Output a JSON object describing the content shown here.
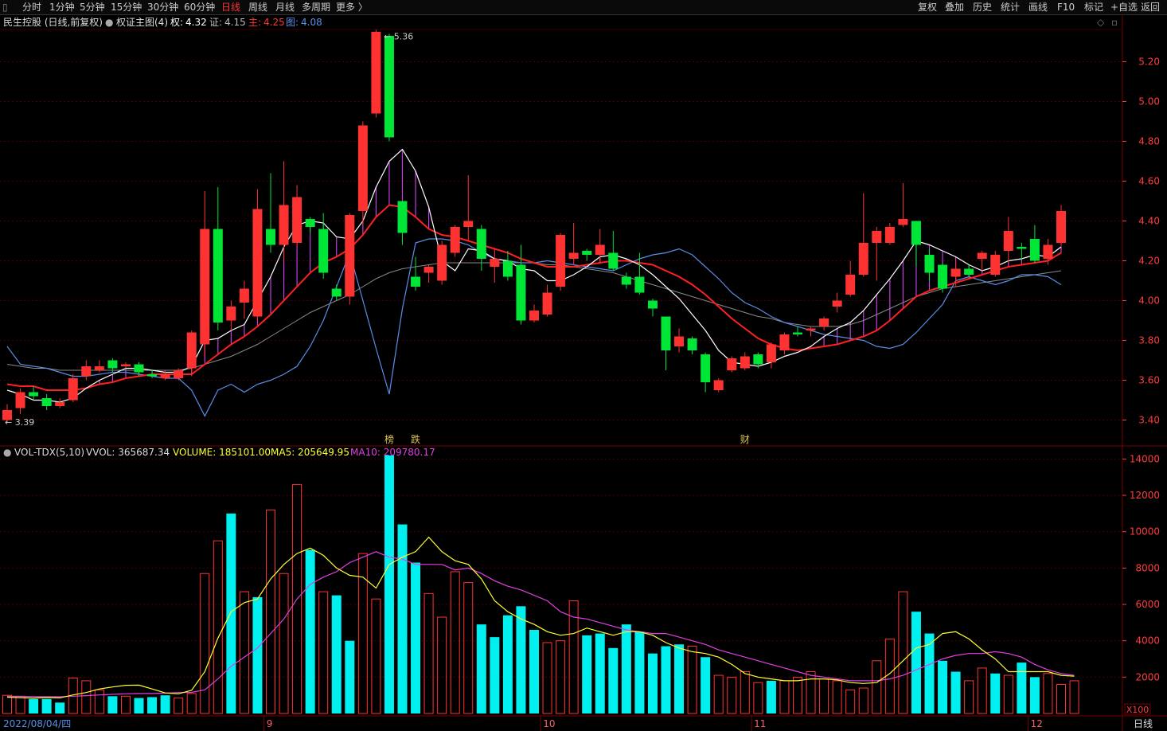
{
  "toolbar": {
    "left_tabs": [
      "分时",
      "1分钟",
      "5分钟",
      "15分钟",
      "30分钟",
      "60分钟",
      "日线",
      "周线",
      "月线",
      "多周期",
      "更多 〉"
    ],
    "active_tab": "日线",
    "right_buttons": [
      "复权",
      "叠加",
      "历史",
      "统计",
      "画线",
      "F10",
      "标记",
      "+自选",
      "返回"
    ]
  },
  "info": {
    "stock": "民生控股 (日线,前复权)",
    "indicator": "权证主图(4)",
    "quan_label": "权:",
    "quan": "4.32",
    "zheng_label": "证:",
    "zheng": "4.15",
    "zhu_label": "主:",
    "zhu": "4.25",
    "tu_label": "图:",
    "tu": "4.08"
  },
  "vol_info": {
    "name": "VOL-TDX(5,10)",
    "vvol": "VVOL: 365687.34",
    "volume": "VOLUME: 185101.00",
    "ma5": "MA5: 205649.95",
    "ma10": "MA10: 209780.17"
  },
  "colors": {
    "up": "#ff3232",
    "down": "#00e636",
    "vol_down": "#00f0f0",
    "ma5": "#ffffff",
    "ma10": "#ff2020",
    "slow_line": "#5a8ee6",
    "vol_ma5": "#ffff30",
    "vol_ma10": "#e040e0",
    "axis_price": "#ff3c3c",
    "grid": "#4a0000"
  },
  "chart_data": [
    {
      "type": "candlestick",
      "title": "民生控股 (日线,前复权)",
      "ylim": [
        3.35,
        5.35
      ],
      "yticks": [
        "5.20",
        "5.00",
        "4.80",
        "4.60",
        "4.40",
        "4.20",
        "4.00",
        "3.80",
        "3.60",
        "3.40"
      ],
      "high_label": "5.36",
      "low_label": "3.39",
      "event_marks": [
        "榜",
        "跌",
        "财"
      ],
      "candles": [
        {
          "o": 3.4,
          "c": 3.45,
          "h": 3.48,
          "l": 3.39
        },
        {
          "o": 3.46,
          "c": 3.54,
          "h": 3.56,
          "l": 3.43
        },
        {
          "o": 3.54,
          "c": 3.52,
          "h": 3.57,
          "l": 3.5
        },
        {
          "o": 3.51,
          "c": 3.47,
          "h": 3.53,
          "l": 3.45
        },
        {
          "o": 3.47,
          "c": 3.49,
          "h": 3.51,
          "l": 3.46
        },
        {
          "o": 3.5,
          "c": 3.61,
          "h": 3.63,
          "l": 3.49
        },
        {
          "o": 3.62,
          "c": 3.67,
          "h": 3.7,
          "l": 3.6
        },
        {
          "o": 3.65,
          "c": 3.67,
          "h": 3.7,
          "l": 3.64
        },
        {
          "o": 3.7,
          "c": 3.66,
          "h": 3.71,
          "l": 3.64
        },
        {
          "o": 3.67,
          "c": 3.68,
          "h": 3.69,
          "l": 3.66
        },
        {
          "o": 3.68,
          "c": 3.64,
          "h": 3.69,
          "l": 3.62
        },
        {
          "o": 3.63,
          "c": 3.62,
          "h": 3.65,
          "l": 3.61
        },
        {
          "o": 3.61,
          "c": 3.63,
          "h": 3.65,
          "l": 3.6
        },
        {
          "o": 3.61,
          "c": 3.65,
          "h": 3.66,
          "l": 3.6
        },
        {
          "o": 3.66,
          "c": 3.84,
          "h": 3.85,
          "l": 3.62
        },
        {
          "o": 3.78,
          "c": 4.36,
          "h": 4.55,
          "l": 3.72
        },
        {
          "o": 4.36,
          "c": 3.89,
          "h": 4.57,
          "l": 3.85
        },
        {
          "o": 3.9,
          "c": 3.97,
          "h": 4.0,
          "l": 3.85
        },
        {
          "o": 3.99,
          "c": 4.06,
          "h": 4.1,
          "l": 3.91
        },
        {
          "o": 3.92,
          "c": 4.46,
          "h": 4.56,
          "l": 3.9
        },
        {
          "o": 4.36,
          "c": 4.28,
          "h": 4.64,
          "l": 4.24
        },
        {
          "o": 4.28,
          "c": 4.48,
          "h": 4.7,
          "l": 4.2
        },
        {
          "o": 4.29,
          "c": 4.52,
          "h": 4.58,
          "l": 4.27
        },
        {
          "o": 4.41,
          "c": 4.37,
          "h": 4.42,
          "l": 4.34
        },
        {
          "o": 4.36,
          "c": 4.14,
          "h": 4.44,
          "l": 4.11
        },
        {
          "o": 4.06,
          "c": 4.02,
          "h": 4.08,
          "l": 4.0
        },
        {
          "o": 4.02,
          "c": 4.43,
          "h": 4.44,
          "l": 3.98
        },
        {
          "o": 4.45,
          "c": 4.88,
          "h": 4.9,
          "l": 4.38
        },
        {
          "o": 4.94,
          "c": 5.35,
          "h": 5.36,
          "l": 4.92
        },
        {
          "o": 5.33,
          "c": 4.82,
          "h": 5.34,
          "l": 4.8
        },
        {
          "o": 4.5,
          "c": 4.34,
          "h": 4.5,
          "l": 4.28
        },
        {
          "o": 4.12,
          "c": 4.07,
          "h": 4.22,
          "l": 4.05
        },
        {
          "o": 4.14,
          "c": 4.17,
          "h": 4.18,
          "l": 4.09
        },
        {
          "o": 4.1,
          "c": 4.28,
          "h": 4.3,
          "l": 4.08
        },
        {
          "o": 4.24,
          "c": 4.37,
          "h": 4.38,
          "l": 4.22
        },
        {
          "o": 4.37,
          "c": 4.4,
          "h": 4.63,
          "l": 4.3
        },
        {
          "o": 4.36,
          "c": 4.21,
          "h": 4.38,
          "l": 4.15
        },
        {
          "o": 4.17,
          "c": 4.21,
          "h": 4.26,
          "l": 4.09
        },
        {
          "o": 4.2,
          "c": 4.12,
          "h": 4.25,
          "l": 4.1
        },
        {
          "o": 4.18,
          "c": 3.9,
          "h": 4.28,
          "l": 3.88
        },
        {
          "o": 3.9,
          "c": 3.95,
          "h": 3.98,
          "l": 3.89
        },
        {
          "o": 3.93,
          "c": 4.04,
          "h": 4.08,
          "l": 3.92
        },
        {
          "o": 4.07,
          "c": 4.33,
          "h": 4.34,
          "l": 4.05
        },
        {
          "o": 4.21,
          "c": 4.24,
          "h": 4.39,
          "l": 4.18
        },
        {
          "o": 4.25,
          "c": 4.23,
          "h": 4.26,
          "l": 4.2
        },
        {
          "o": 4.23,
          "c": 4.28,
          "h": 4.36,
          "l": 4.19
        },
        {
          "o": 4.24,
          "c": 4.16,
          "h": 4.35,
          "l": 4.15
        },
        {
          "o": 4.12,
          "c": 4.08,
          "h": 4.14,
          "l": 4.06
        },
        {
          "o": 4.12,
          "c": 4.04,
          "h": 4.24,
          "l": 4.03
        },
        {
          "o": 4.0,
          "c": 3.96,
          "h": 4.01,
          "l": 3.92
        },
        {
          "o": 3.92,
          "c": 3.75,
          "h": 3.92,
          "l": 3.65
        },
        {
          "o": 3.77,
          "c": 3.82,
          "h": 3.86,
          "l": 3.74
        },
        {
          "o": 3.81,
          "c": 3.75,
          "h": 3.82,
          "l": 3.73
        },
        {
          "o": 3.73,
          "c": 3.59,
          "h": 3.74,
          "l": 3.54
        },
        {
          "o": 3.55,
          "c": 3.6,
          "h": 3.61,
          "l": 3.54
        },
        {
          "o": 3.65,
          "c": 3.71,
          "h": 3.72,
          "l": 3.64
        },
        {
          "o": 3.66,
          "c": 3.72,
          "h": 3.74,
          "l": 3.65
        },
        {
          "o": 3.73,
          "c": 3.68,
          "h": 3.74,
          "l": 3.66
        },
        {
          "o": 3.69,
          "c": 3.78,
          "h": 3.79,
          "l": 3.66
        },
        {
          "o": 3.75,
          "c": 3.83,
          "h": 3.84,
          "l": 3.73
        },
        {
          "o": 3.84,
          "c": 3.83,
          "h": 3.87,
          "l": 3.82
        },
        {
          "o": 3.85,
          "c": 3.86,
          "h": 3.87,
          "l": 3.82
        },
        {
          "o": 3.87,
          "c": 3.91,
          "h": 3.92,
          "l": 3.85
        },
        {
          "o": 3.97,
          "c": 4.0,
          "h": 4.04,
          "l": 3.94
        },
        {
          "o": 4.03,
          "c": 4.13,
          "h": 4.2,
          "l": 4.02
        },
        {
          "o": 4.13,
          "c": 4.29,
          "h": 4.54,
          "l": 4.12
        },
        {
          "o": 4.29,
          "c": 4.35,
          "h": 4.37,
          "l": 4.1
        },
        {
          "o": 4.29,
          "c": 4.37,
          "h": 4.39,
          "l": 4.28
        },
        {
          "o": 4.38,
          "c": 4.41,
          "h": 4.59,
          "l": 4.37
        },
        {
          "o": 4.4,
          "c": 4.28,
          "h": 4.4,
          "l": 4.17
        },
        {
          "o": 4.23,
          "c": 4.14,
          "h": 4.26,
          "l": 4.1
        },
        {
          "o": 4.18,
          "c": 4.06,
          "h": 4.19,
          "l": 4.04
        },
        {
          "o": 4.12,
          "c": 4.16,
          "h": 4.2,
          "l": 4.07
        },
        {
          "o": 4.16,
          "c": 4.13,
          "h": 4.18,
          "l": 4.12
        },
        {
          "o": 4.21,
          "c": 4.24,
          "h": 4.25,
          "l": 4.15
        },
        {
          "o": 4.13,
          "c": 4.23,
          "h": 4.25,
          "l": 4.12
        },
        {
          "o": 4.25,
          "c": 4.35,
          "h": 4.42,
          "l": 4.19
        },
        {
          "o": 4.27,
          "c": 4.26,
          "h": 4.29,
          "l": 4.2
        },
        {
          "o": 4.31,
          "c": 4.2,
          "h": 4.38,
          "l": 4.19
        },
        {
          "o": 4.21,
          "c": 4.28,
          "h": 4.31,
          "l": 4.18
        },
        {
          "o": 4.29,
          "c": 4.45,
          "h": 4.48,
          "l": 4.27
        }
      ],
      "ma_fast": [
        3.55,
        3.53,
        3.5,
        3.5,
        3.49,
        3.51,
        3.56,
        3.6,
        3.63,
        3.66,
        3.66,
        3.65,
        3.64,
        3.64,
        3.67,
        3.8,
        3.81,
        3.85,
        3.88,
        4.0,
        4.12,
        4.27,
        4.38,
        4.4,
        4.39,
        4.32,
        4.31,
        4.4,
        4.57,
        4.7,
        4.76,
        4.65,
        4.47,
        4.2,
        4.15,
        4.26,
        4.25,
        4.21,
        4.2,
        4.16,
        4.15,
        4.1,
        4.1,
        4.13,
        4.17,
        4.22,
        4.23,
        4.21,
        4.18,
        4.13,
        4.07,
        4.01,
        3.93,
        3.85,
        3.75,
        3.69,
        3.68,
        3.67,
        3.69,
        3.72,
        3.74,
        3.77,
        3.82,
        3.86,
        3.89,
        3.95,
        4.03,
        4.11,
        4.2,
        4.3,
        4.28,
        4.25,
        4.22,
        4.18,
        4.15,
        4.17,
        4.2,
        4.21,
        4.23,
        4.22,
        4.27
      ],
      "ma_mid": [
        3.58,
        3.57,
        3.57,
        3.55,
        3.55,
        3.55,
        3.56,
        3.58,
        3.59,
        3.61,
        3.62,
        3.63,
        3.63,
        3.63,
        3.63,
        3.68,
        3.73,
        3.78,
        3.82,
        3.87,
        3.93,
        4.0,
        4.07,
        4.14,
        4.19,
        4.22,
        4.26,
        4.33,
        4.42,
        4.48,
        4.47,
        4.42,
        4.36,
        4.33,
        4.32,
        4.3,
        4.28,
        4.26,
        4.24,
        4.21,
        4.19,
        4.17,
        4.17,
        4.17,
        4.18,
        4.19,
        4.2,
        4.2,
        4.19,
        4.18,
        4.15,
        4.12,
        4.08,
        4.03,
        3.97,
        3.91,
        3.86,
        3.81,
        3.78,
        3.76,
        3.75,
        3.76,
        3.77,
        3.78,
        3.8,
        3.82,
        3.85,
        3.9,
        3.96,
        4.02,
        4.05,
        4.07,
        4.09,
        4.11,
        4.13,
        4.15,
        4.17,
        4.18,
        4.19,
        4.2,
        4.24
      ],
      "ma_slow": [
        3.77,
        3.68,
        3.67,
        3.66,
        3.64,
        3.62,
        3.62,
        3.63,
        3.64,
        3.64,
        3.63,
        3.62,
        3.61,
        3.61,
        3.55,
        3.42,
        3.55,
        3.58,
        3.54,
        3.58,
        3.6,
        3.63,
        3.67,
        3.77,
        3.9,
        4.07,
        4.24,
        4.0,
        3.76,
        3.53,
        3.96,
        4.29,
        4.31,
        4.31,
        4.3,
        4.28,
        4.24,
        4.21,
        4.2,
        4.19,
        4.19,
        4.2,
        4.19,
        4.18,
        4.17,
        4.16,
        4.15,
        4.18,
        4.21,
        4.23,
        4.24,
        4.26,
        4.23,
        4.17,
        4.11,
        4.04,
        3.99,
        3.96,
        3.92,
        3.89,
        3.87,
        3.85,
        3.83,
        3.82,
        3.81,
        3.8,
        3.77,
        3.76,
        3.78,
        3.84,
        3.91,
        3.98,
        4.1,
        4.12,
        4.1,
        4.08,
        4.1,
        4.13,
        4.13,
        4.12,
        4.08
      ],
      "ma_long": [
        3.68,
        3.67,
        3.66,
        3.66,
        3.65,
        3.65,
        3.65,
        3.65,
        3.65,
        3.65,
        3.65,
        3.65,
        3.65,
        3.65,
        3.66,
        3.68,
        3.7,
        3.72,
        3.75,
        3.78,
        3.82,
        3.86,
        3.9,
        3.94,
        3.97,
        4.0,
        4.03,
        4.07,
        4.11,
        4.14,
        4.16,
        4.17,
        4.18,
        4.19,
        4.19,
        4.19,
        4.19,
        4.19,
        4.19,
        4.19,
        4.19,
        4.18,
        4.18,
        4.17,
        4.16,
        4.15,
        4.14,
        4.12,
        4.1,
        4.08,
        4.06,
        4.04,
        4.02,
        4.0,
        3.98,
        3.96,
        3.94,
        3.92,
        3.91,
        3.89,
        3.88,
        3.87,
        3.87,
        3.87,
        3.88,
        3.9,
        3.93,
        3.96,
        3.99,
        4.02,
        4.04,
        4.06,
        4.07,
        4.08,
        4.09,
        4.1,
        4.11,
        4.12,
        4.13,
        4.14,
        4.15
      ]
    },
    {
      "type": "bar",
      "title": "VOL-TDX(5,10)",
      "ylim": [
        0,
        14500
      ],
      "yticks": [
        "14000",
        "12000",
        "10000",
        "8000",
        "6000",
        "4000",
        "2000"
      ],
      "unit_label": "X100",
      "x_labels": [
        "2022/08/04/四",
        "9",
        "10",
        "11",
        "12"
      ],
      "x_label_index": [
        0,
        20,
        41,
        57,
        78
      ],
      "period_label": "日线",
      "volume": [
        1000,
        950,
        800,
        800,
        600,
        1950,
        1800,
        1300,
        950,
        950,
        850,
        900,
        1000,
        850,
        1100,
        7700,
        9500,
        11000,
        6700,
        6400,
        11200,
        7700,
        12600,
        9000,
        6700,
        6500,
        4000,
        8800,
        6300,
        14200,
        10400,
        8300,
        6600,
        5300,
        7800,
        7200,
        4900,
        4200,
        5400,
        5900,
        4600,
        3900,
        4000,
        6200,
        4300,
        4400,
        3600,
        4900,
        4500,
        3300,
        3700,
        3800,
        3700,
        3100,
        2100,
        2000,
        2300,
        1700,
        1800,
        1800,
        2000,
        2300,
        1900,
        1800,
        1300,
        1400,
        2900,
        4100,
        6700,
        5600,
        4400,
        2900,
        2300,
        1800,
        2500,
        2200,
        2100,
        2800,
        2000,
        2200,
        1600,
        1800
      ],
      "vol_down_index": [
        2,
        3,
        4,
        8,
        10,
        11,
        12,
        17,
        19,
        23,
        25,
        26,
        29,
        30,
        31,
        36,
        37,
        38,
        39,
        40,
        44,
        45,
        46,
        47,
        48,
        49,
        50,
        51,
        53,
        58,
        69,
        70,
        71,
        72,
        75,
        77,
        78
      ],
      "vol_ma5": [
        900,
        870,
        850,
        880,
        860,
        1020,
        1150,
        1350,
        1460,
        1550,
        1560,
        1350,
        1130,
        1080,
        1280,
        2300,
        4150,
        5600,
        6100,
        6300,
        7400,
        8200,
        8800,
        9100,
        8700,
        8000,
        7600,
        7500,
        6900,
        8200,
        8600,
        8900,
        9700,
        8900,
        8400,
        8200,
        7400,
        6200,
        5600,
        5200,
        4900,
        4500,
        4300,
        4400,
        4700,
        4500,
        4300,
        4500,
        4500,
        4300,
        3900,
        3600,
        3400,
        3300,
        3100,
        2700,
        2200,
        2000,
        1900,
        1800,
        1800,
        1900,
        1900,
        1850,
        1700,
        1650,
        1700,
        2200,
        2900,
        3600,
        3800,
        4400,
        4500,
        4100,
        3500,
        3000,
        2300,
        2300,
        2300,
        2300,
        2100,
        2050
      ],
      "vol_ma10": [
        950,
        940,
        930,
        920,
        920,
        950,
        980,
        1020,
        1050,
        1080,
        1100,
        1100,
        1120,
        1150,
        1160,
        1300,
        1900,
        2600,
        3100,
        3600,
        4400,
        5200,
        6300,
        7100,
        7500,
        7800,
        8300,
        8600,
        8900,
        8600,
        8500,
        8200,
        8200,
        8200,
        7900,
        8000,
        7700,
        7300,
        7000,
        6800,
        6500,
        6200,
        5600,
        5300,
        5200,
        5000,
        4800,
        4600,
        4500,
        4400,
        4400,
        4200,
        4000,
        3800,
        3500,
        3300,
        3100,
        2900,
        2700,
        2500,
        2300,
        2100,
        2000,
        1900,
        1800,
        1800,
        1800,
        1900,
        2100,
        2400,
        2700,
        3000,
        3200,
        3300,
        3300,
        3400,
        3300,
        3100,
        2700,
        2400,
        2200,
        2100
      ]
    }
  ]
}
